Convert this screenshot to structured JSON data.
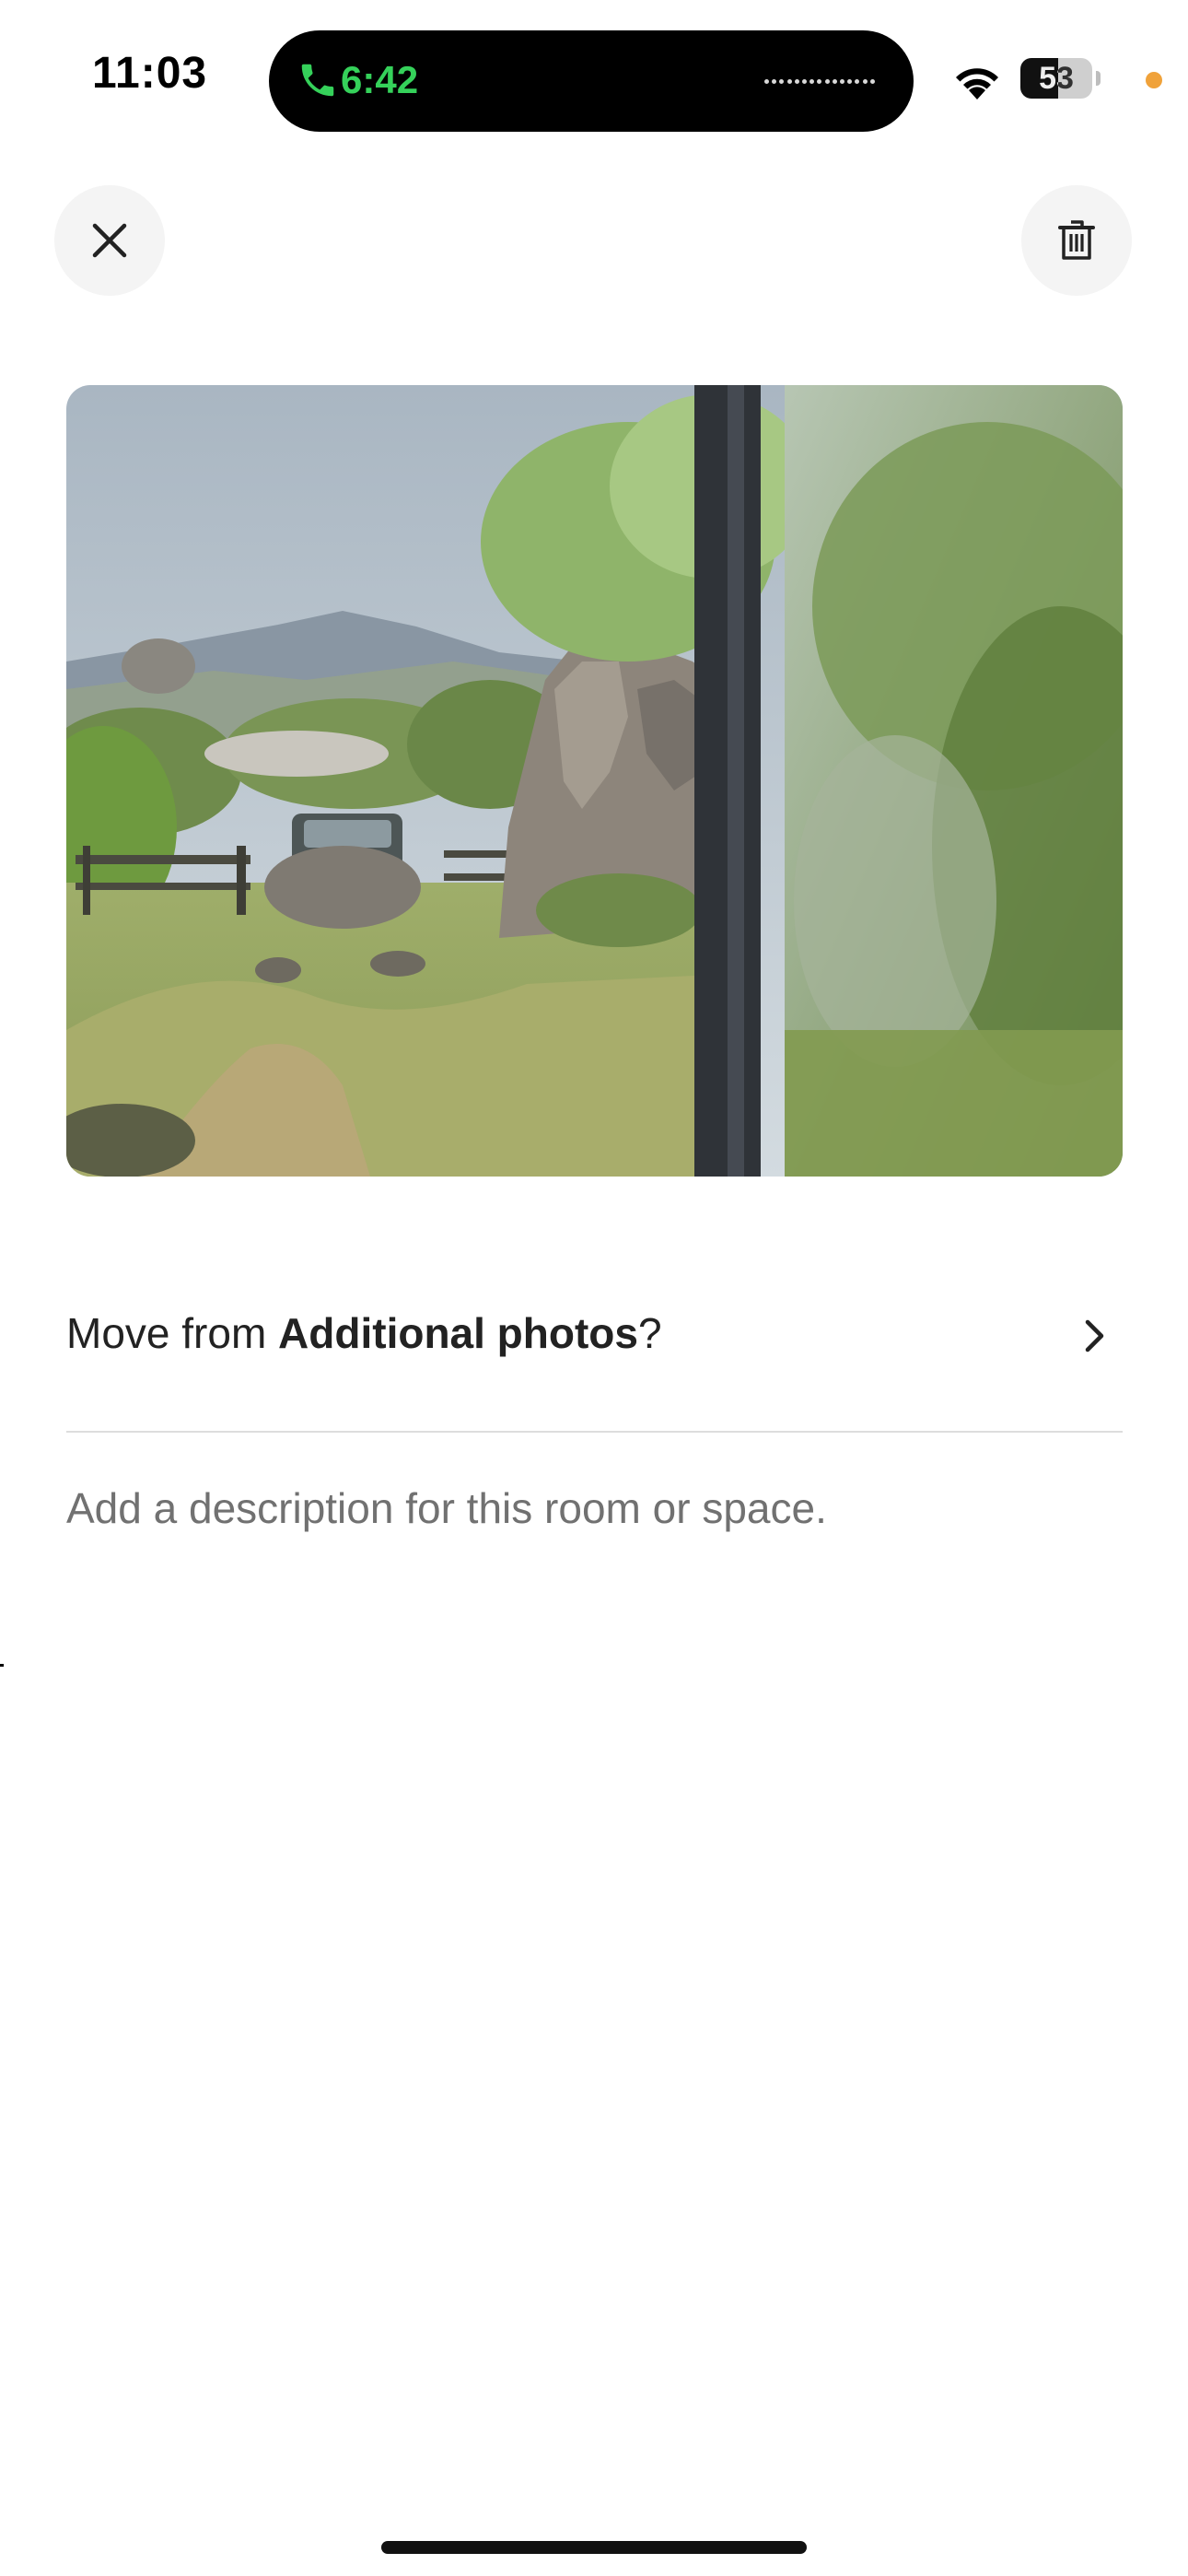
{
  "status_bar": {
    "time": "11:03",
    "call_duration": "6:42",
    "battery_level": "53",
    "battery_fraction": 0.53
  },
  "header": {
    "close_icon": "close-icon",
    "delete_icon": "trash-icon"
  },
  "photo": {
    "icon": "photo"
  },
  "move_row": {
    "prefix": "Move from ",
    "category": "Additional photos",
    "suffix": "?",
    "icon": "chevron-right-icon"
  },
  "description": {
    "value": "",
    "placeholder": "Add a description for this room or space."
  },
  "colors": {
    "call_green": "#35d15a",
    "privacy_dot": "#f0a23a",
    "button_bg": "#f4f4f4",
    "divider": "#dddddd",
    "placeholder": "#717171"
  }
}
